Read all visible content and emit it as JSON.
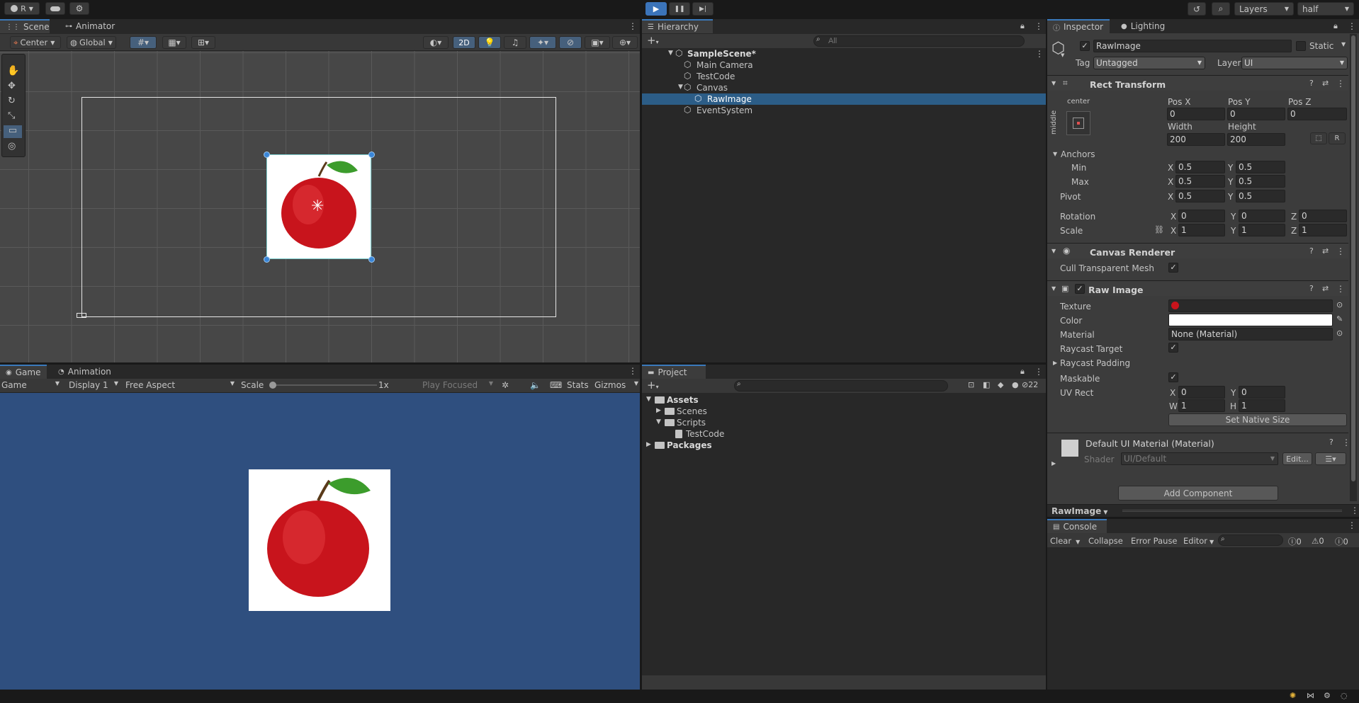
{
  "toolbar": {
    "account": "R",
    "play": "▶",
    "pause": "❚❚",
    "step": "▶|",
    "layers": "Layers",
    "layout": "half"
  },
  "scene": {
    "tab_scene": "Scene",
    "tab_animator": "Animator",
    "pivot": "Center",
    "space": "Global",
    "mode_2d": "2D"
  },
  "game": {
    "tab_game": "Game",
    "tab_animation": "Animation",
    "view": "Game",
    "display": "Display 1",
    "aspect": "Free Aspect",
    "scale_label": "Scale",
    "scale_value": "1x",
    "play_focused": "Play Focused",
    "stats": "Stats",
    "gizmos": "Gizmos",
    "background": "#2f4f7f"
  },
  "hierarchy": {
    "title": "Hierarchy",
    "search_placeholder": "All",
    "items": [
      {
        "label": "SampleScene*"
      },
      {
        "label": "Main Camera"
      },
      {
        "label": "TestCode"
      },
      {
        "label": "Canvas"
      },
      {
        "label": "RawImage"
      },
      {
        "label": "EventSystem"
      }
    ]
  },
  "project": {
    "title": "Project",
    "count": "22",
    "items": [
      {
        "label": "Assets"
      },
      {
        "label": "Scenes"
      },
      {
        "label": "Scripts"
      },
      {
        "label": "TestCode"
      },
      {
        "label": "Packages"
      }
    ]
  },
  "inspector": {
    "tab_inspector": "Inspector",
    "tab_lighting": "Lighting",
    "object_name": "RawImage",
    "static_label": "Static",
    "tag_label": "Tag",
    "tag_value": "Untagged",
    "layer_label": "Layer",
    "layer_value": "UI",
    "rect": {
      "title": "Rect Transform",
      "anchor_h": "center",
      "anchor_v": "middle",
      "posx_label": "Pos X",
      "posy_label": "Pos Y",
      "posz_label": "Pos Z",
      "posx": "0",
      "posy": "0",
      "posz": "0",
      "width_label": "Width",
      "height_label": "Height",
      "width": "200",
      "height": "200",
      "anchors": "Anchors",
      "min": "Min",
      "max": "Max",
      "min_x": "0.5",
      "min_y": "0.5",
      "max_x": "0.5",
      "max_y": "0.5",
      "pivot": "Pivot",
      "pivot_x": "0.5",
      "pivot_y": "0.5",
      "rotation": "Rotation",
      "rot_x": "0",
      "rot_y": "0",
      "rot_z": "0",
      "scale": "Scale",
      "scale_x": "1",
      "scale_y": "1",
      "scale_z": "1",
      "x": "X",
      "y": "Y",
      "z": "Z",
      "r_btn": "R"
    },
    "canvas_renderer": {
      "title": "Canvas Renderer",
      "cull": "Cull Transparent Mesh"
    },
    "raw_image": {
      "title": "Raw Image",
      "texture": "Texture",
      "color": "Color",
      "material": "Material",
      "material_value": "None (Material)",
      "raycast_target": "Raycast Target",
      "raycast_padding": "Raycast Padding",
      "maskable": "Maskable",
      "uv_rect": "UV Rect",
      "uv_x": "0",
      "uv_y": "0",
      "uv_w": "1",
      "uv_h": "1",
      "w": "W",
      "h": "H",
      "set_native": "Set Native Size"
    },
    "material": {
      "title": "Default UI Material (Material)",
      "shader_label": "Shader",
      "shader_value": "UI/Default",
      "edit": "Edit..."
    },
    "add_component": "Add Component",
    "preview_label": "RawImage"
  },
  "console": {
    "title": "Console",
    "clear": "Clear",
    "collapse": "Collapse",
    "error_pause": "Error Pause",
    "editor": "Editor",
    "count_errors": "0",
    "count_warnings": "0",
    "count_logs": "0"
  }
}
